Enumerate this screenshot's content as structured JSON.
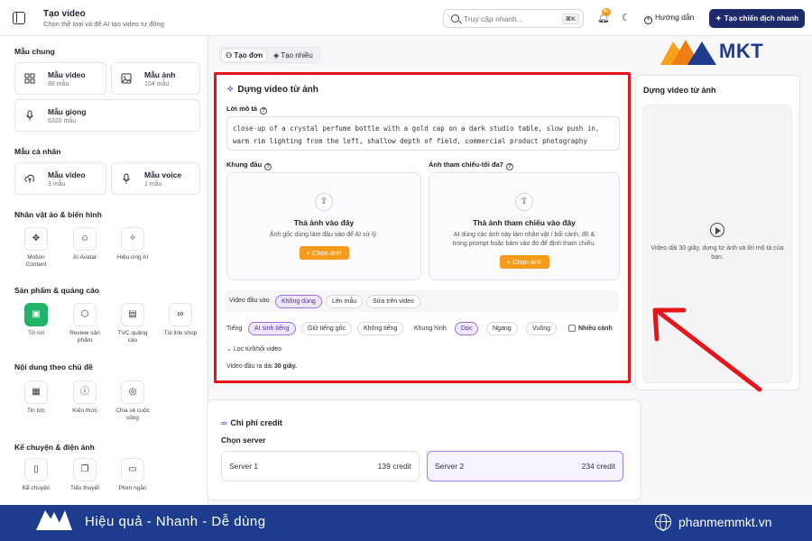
{
  "header": {
    "title": "Tạo video",
    "subtitle": "Chọn thể loại và để AI tạo video tự động",
    "search_placeholder": "Truy cập nhanh...",
    "search_kbd": "⌘K",
    "notif_badge": "9+",
    "help_label": "Hướng dẫn",
    "cta_label": "Tạo chiến dịch nhanh"
  },
  "sidebar": {
    "sections": {
      "common": "Mẫu chung",
      "personal": "Mẫu cá nhân",
      "avatar": "Nhân vật ảo & biến hình",
      "product": "Sản phẩm & quảng cáo",
      "topic": "Nội dung theo chủ đề",
      "story": "Kể chuyện & điện ảnh"
    },
    "common_templates": [
      {
        "name": "Mẫu video",
        "count": "88 mẫu"
      },
      {
        "name": "Mẫu ảnh",
        "count": "104 mẫu"
      },
      {
        "name": "Mẫu giọng",
        "count": "6320 mẫu"
      }
    ],
    "personal_templates": [
      {
        "name": "Mẫu video",
        "count": "3 mẫu"
      },
      {
        "name": "Mẫu voice",
        "count": "1 mẫu"
      }
    ],
    "avatar_tools": [
      "Motion Content",
      "AI Avatar",
      "Hiệu ứng AI"
    ],
    "product_tools": [
      "Tờ rơi",
      "Review sản phẩm",
      "TVC quảng cáo",
      "Túi link shop"
    ],
    "topic_tools": [
      "Tin tức",
      "Kiến thức",
      "Chia sẻ cuộc sống"
    ],
    "story_tools": [
      "Kể chuyện",
      "Tiểu thuyết",
      "Phim ngắn"
    ]
  },
  "mode_toggle": {
    "single": "Tạo đơn",
    "multi": "Tạo nhiều"
  },
  "form": {
    "title": "Dựng video từ ảnh",
    "prompt_label": "Lời mô tả",
    "prompt_value": "close-up of a crystal perfume bottle with a gold cap on a dark studio table, slow push in, warm rim lighting from the left, shallow depth of field, commercial product photography",
    "first_frame_label": "Khung đầu",
    "ref_label": "Ảnh tham chiếu-tối đa7",
    "drop1": {
      "title": "Thả ảnh vào đây",
      "desc": "Ảnh gốc dùng làm đầu vào để AI xử lý.",
      "button": "+ Chọn ảnh"
    },
    "drop2": {
      "title": "Thả ảnh tham chiếu vào đây",
      "desc": "AI dùng các ảnh này làm nhân vật / bối cảnh, đồ & trong prompt hoặc bám vào đó để định tham chiếu.",
      "button": "+ Chọn ảnh"
    },
    "video_input_label": "Video đầu vào",
    "video_input_options": [
      "Không dùng",
      "Lên mẫu",
      "Sửa trên video"
    ],
    "ratio_label": "Tiếng",
    "ratio_options": [
      "AI sinh tiếng",
      "Giữ tiếng gốc",
      "Không tiếng"
    ],
    "frame_label": "Khung hình",
    "frame_options": [
      "Dọc",
      "Ngang",
      "Vuông"
    ],
    "multi_scene": "Nhiều cảnh",
    "filter_label": "Lọc từ/khối video",
    "output_prefix": "Video đầu ra dài ",
    "output_value": "30 giây."
  },
  "preview": {
    "title": "Dựng video từ ảnh",
    "text": "Video dài 30 giây, dựng từ ảnh và lời mô tả của bạn."
  },
  "cost": {
    "title": "Chi phí credit",
    "server_label": "Chọn server",
    "servers": [
      {
        "name": "Server 1",
        "credit": "139 credit"
      },
      {
        "name": "Server 2",
        "credit": "234 credit"
      }
    ]
  },
  "branding": {
    "logo_text": "MKT",
    "slogan": "Hiệu quả - Nhanh - Dễ dùng",
    "site": "phanmemmkt.vn"
  },
  "colors": {
    "accent": "#7b4ad9",
    "orange": "#f59a1a",
    "brand_blue": "#1d3c8e",
    "highlight_red": "#e3161c"
  }
}
